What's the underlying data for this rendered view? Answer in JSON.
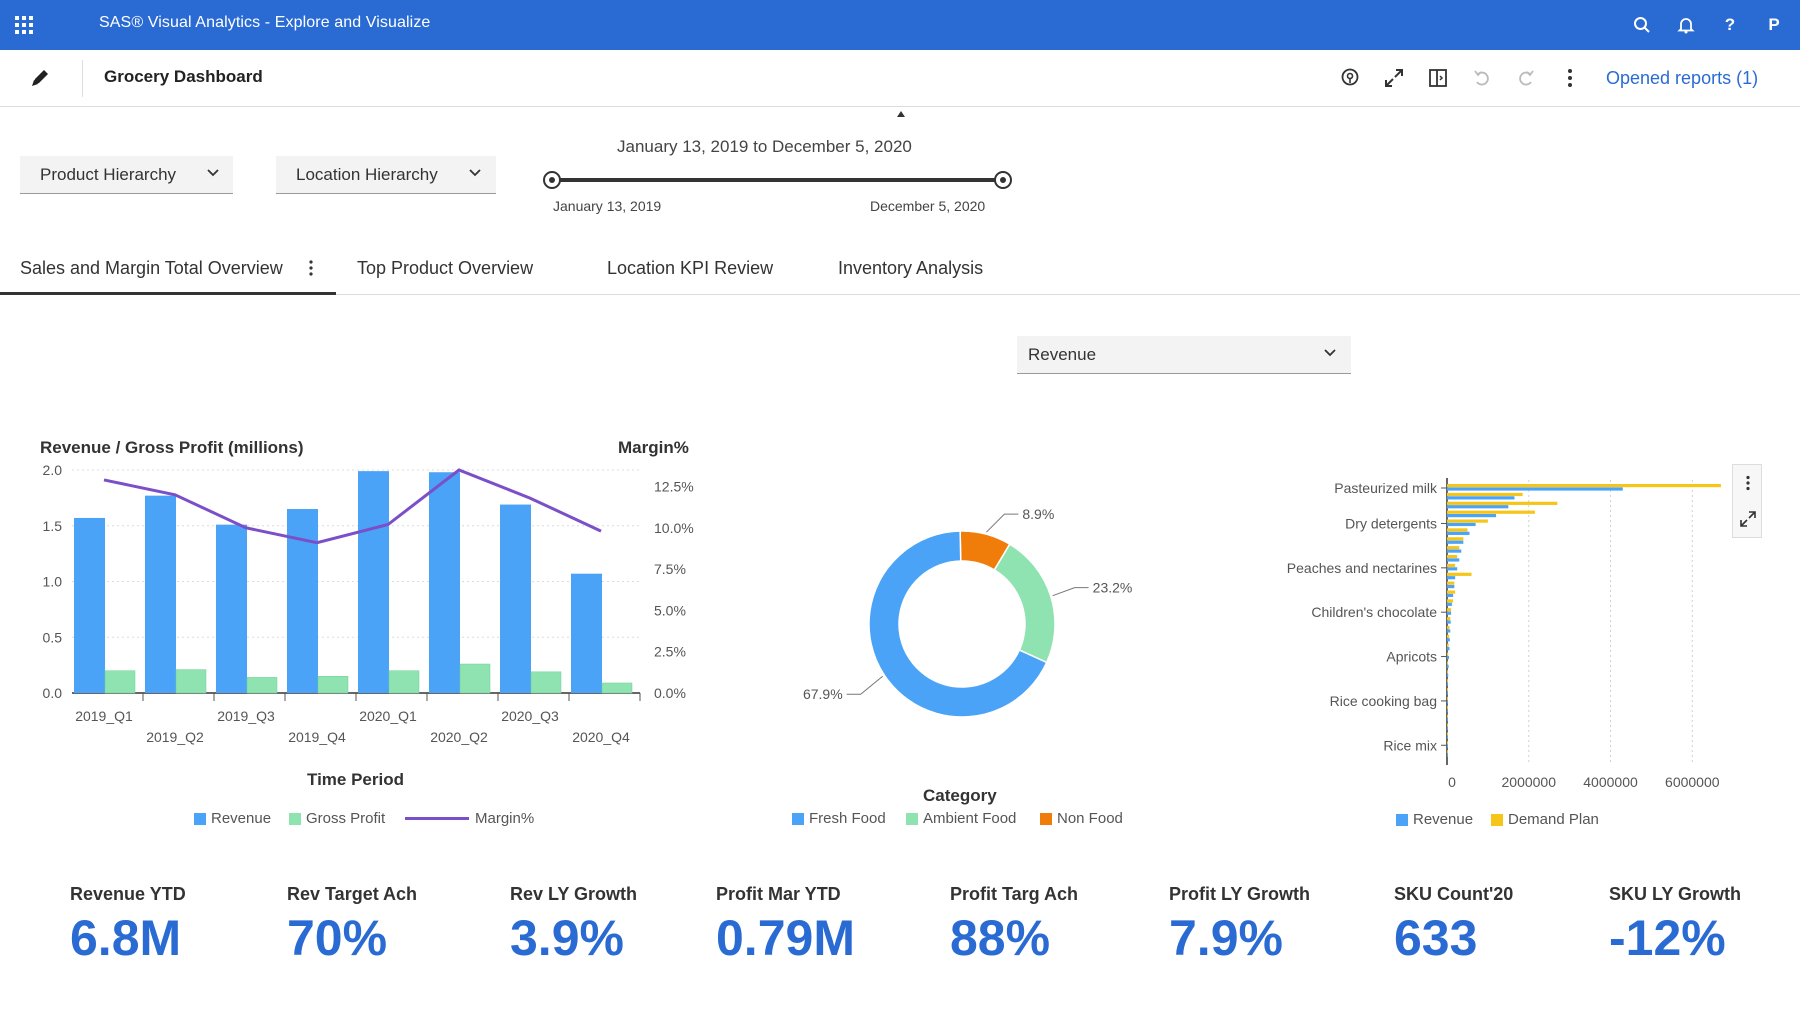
{
  "app": {
    "title": "SAS® Visual Analytics - Explore and Visualize",
    "user_initial": "P",
    "icons": [
      "apps-grid-icon",
      "search-icon",
      "bell-icon",
      "help-icon"
    ]
  },
  "toolbar": {
    "report_title": "Grocery Dashboard",
    "opened_reports": "Opened reports (1)",
    "icons": [
      "edit-icon",
      "location-pin-icon",
      "expand-icon",
      "split-view-icon",
      "undo-icon",
      "redo-icon",
      "more-icon"
    ]
  },
  "filters": {
    "product": "Product Hierarchy",
    "location": "Location Hierarchy",
    "date_range_title": "January 13, 2019 to December 5, 2020",
    "date_start": "January 13, 2019",
    "date_end": "December 5, 2020",
    "measure_select": "Revenue"
  },
  "tabs": [
    {
      "label": "Sales and Margin Total Overview",
      "active": true
    },
    {
      "label": "Top Product Overview",
      "active": false
    },
    {
      "label": "Location KPI Review",
      "active": false
    },
    {
      "label": "Inventory Analysis",
      "active": false
    }
  ],
  "colors": {
    "brand": "#2a6bd3",
    "revenue": "#4aa3f7",
    "gross_profit": "#8ee3b0",
    "margin": "#7b4fc8",
    "non_food": "#f07c0a",
    "demand_plan": "#f5c518"
  },
  "chart_data": [
    {
      "type": "bar",
      "title": "Revenue / Gross Profit (millions)",
      "y2label": "Margin%",
      "xlabel": "Time Period",
      "categories": [
        "2019_Q1",
        "2019_Q2",
        "2019_Q3",
        "2019_Q4",
        "2020_Q1",
        "2020_Q2",
        "2020_Q3",
        "2020_Q4"
      ],
      "ylim": [
        0,
        2.0
      ],
      "yticks": [
        "0.0",
        "0.5",
        "1.0",
        "1.5",
        "2.0"
      ],
      "y2lim": [
        0,
        13.5
      ],
      "y2ticks": [
        "0.0%",
        "2.5%",
        "5.0%",
        "7.5%",
        "10.0%",
        "12.5%"
      ],
      "series": [
        {
          "name": "Revenue",
          "kind": "bar",
          "values": [
            1.57,
            1.77,
            1.51,
            1.65,
            1.99,
            1.98,
            1.69,
            1.07
          ]
        },
        {
          "name": "Gross Profit",
          "kind": "bar",
          "values": [
            0.2,
            0.21,
            0.14,
            0.15,
            0.2,
            0.26,
            0.19,
            0.09
          ]
        },
        {
          "name": "Margin%",
          "kind": "line",
          "values": [
            12.9,
            12.0,
            10.0,
            9.1,
            10.2,
            13.5,
            11.8,
            9.8
          ]
        }
      ],
      "legend_position": "bottom",
      "grid": true
    },
    {
      "type": "pie",
      "title": "Category",
      "donut": true,
      "labels": [
        "Fresh Food",
        "Ambient Food",
        "Non Food"
      ],
      "values": [
        67.9,
        23.2,
        8.9
      ],
      "value_labels": [
        "67.9%",
        "23.2%",
        "8.9%"
      ],
      "legend_position": "bottom"
    },
    {
      "type": "bar",
      "orientation": "horizontal",
      "categories_shown": [
        "Pasteurized milk",
        "Dry detergents",
        "Peaches and nectarines",
        "Children's chocolate",
        "Apricots",
        "Rice cooking bag",
        "Rice mix"
      ],
      "xticks": [
        "0",
        "2000000",
        "4000000",
        "6000000"
      ],
      "xlim": [
        0,
        6800000
      ],
      "series": [
        {
          "name": "Revenue",
          "values": [
            4300000,
            1650000,
            1500000,
            1200000,
            700000,
            550000,
            400000,
            350000,
            300000,
            250000,
            200000,
            180000,
            150000,
            120000,
            100000,
            90000,
            80000,
            70000,
            60000,
            50000,
            40000,
            30000,
            25000,
            20000,
            15000,
            12000,
            10000,
            8000,
            6000,
            5000,
            4000
          ]
        },
        {
          "name": "Demand Plan",
          "values": [
            6700000,
            1850000,
            2700000,
            2150000,
            1000000,
            500000,
            400000,
            300000,
            250000,
            200000,
            600000,
            180000,
            200000,
            150000,
            100000,
            80000,
            60000,
            50000,
            40000,
            30000,
            25000,
            20000,
            15000,
            12000,
            10000,
            8000,
            6000,
            5000,
            4000,
            3000,
            2000
          ]
        }
      ],
      "legend_position": "bottom",
      "grid": true
    }
  ],
  "kpis": [
    {
      "label": "Revenue YTD",
      "value": "6.8M"
    },
    {
      "label": "Rev Target Ach",
      "value": "70%"
    },
    {
      "label": "Rev LY Growth",
      "value": "3.9%"
    },
    {
      "label": "Profit Mar YTD",
      "value": "0.79M"
    },
    {
      "label": "Profit Targ Ach",
      "value": "88%"
    },
    {
      "label": "Profit LY Growth",
      "value": "7.9%"
    },
    {
      "label": "SKU Count'20",
      "value": "633"
    },
    {
      "label": "SKU LY Growth",
      "value": "-12%"
    }
  ]
}
